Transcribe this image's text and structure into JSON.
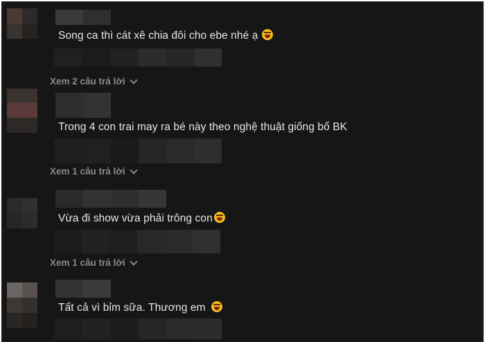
{
  "comments": [
    {
      "text": "Song ca thì cát xê chia đôi cho ebe nhé ạ",
      "emoji": "laughing-tears-emoji",
      "replies_label": "Xem 2 câu trả lời"
    },
    {
      "text": "Trong 4 con trai may ra bé này theo nghệ thuật giống bố BK",
      "emoji": "",
      "replies_label": "Xem 1 câu trả lời"
    },
    {
      "text": "Vừa đi show vừa phải trông con",
      "emoji": "grinning-emoji",
      "replies_label": "Xem 1 câu trả lời"
    },
    {
      "text": "Tất cả vì bỉm sữa. Thương em",
      "emoji": "laughing-tears-emoji",
      "replies_label": ""
    }
  ],
  "colors": {
    "background": "#161616",
    "comment_text": "#e8e8e8",
    "replies_text": "#8a8a8a",
    "frame_border": "#1a1a1a"
  }
}
